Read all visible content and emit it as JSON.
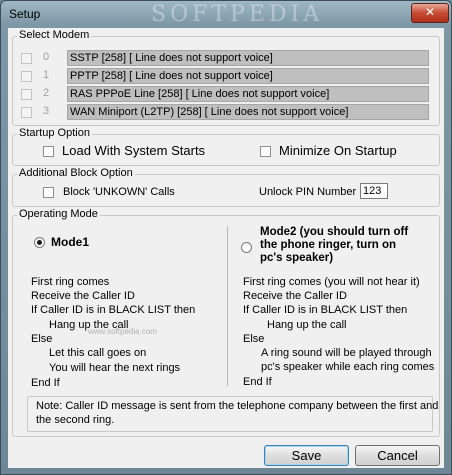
{
  "window": {
    "title": "Setup",
    "watermark": "SOFTPEDIA",
    "close_glyph": "✕"
  },
  "select_modem": {
    "legend": "Select Modem",
    "rows": [
      {
        "index": "0",
        "name": "SSTP  [258] [ Line does not support voice]"
      },
      {
        "index": "1",
        "name": "PPTP  [258] [ Line does not support voice]"
      },
      {
        "index": "2",
        "name": "RAS PPPoE Line  [258] [ Line does not support voice]"
      },
      {
        "index": "3",
        "name": "WAN Miniport (L2TP)  [258] [ Line does not support voice]"
      }
    ]
  },
  "startup_option": {
    "legend": "Startup Option",
    "load_label": "Load With System Starts",
    "minimize_label": "Minimize On Startup"
  },
  "block_option": {
    "legend": "Additional Block Option",
    "block_label": "Block 'UNKOWN' Calls",
    "pin_label": "Unlock PIN Number",
    "pin_value": "123"
  },
  "operating_mode": {
    "legend": "Operating Mode",
    "mode1": {
      "label": "Mode1",
      "lines": [
        "First ring comes",
        "Receive the Caller ID",
        "If Caller ID is in BLACK LIST then",
        "Hang up the call",
        "Else",
        "Let this call goes on",
        "You will hear the next rings",
        "End If"
      ]
    },
    "mode2": {
      "label_lines": [
        "Mode2 (you should turn off",
        "the phone ringer, turn on",
        "pc's speaker)"
      ],
      "lines": [
        "First ring comes (you will not hear it)",
        "Receive the Caller ID",
        "If Caller ID is in BLACK LIST then",
        "Hang up the call",
        "Else",
        "A ring sound will be played through",
        "pc's speaker while each ring comes",
        "End If"
      ]
    },
    "note_lines": [
      "Note: Caller ID message is sent from the telephone company between the first and",
      "the second ring."
    ],
    "watermark_small": "www.softpedia.com"
  },
  "buttons": {
    "save": "Save",
    "cancel": "Cancel"
  }
}
